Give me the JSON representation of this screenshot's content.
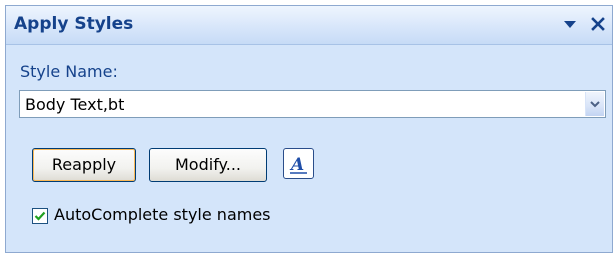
{
  "pane": {
    "title": "Apply Styles",
    "style_name_label": "Style Name:",
    "style_name_value": "Body Text,bt",
    "reapply_label": "Reapply",
    "modify_label": "Modify...",
    "format_icon_text": "A",
    "autocomplete_label": "AutoComplete style names",
    "autocomplete_checked": true
  },
  "icons": {
    "menu": "dropdown-arrow-icon",
    "close": "close-icon",
    "select_arrow": "chevron-down-icon",
    "styles_pane": "styles-pane-icon",
    "checkmark": "checkmark-icon"
  },
  "colors": {
    "title_text": "#15428b",
    "pane_background": "#d4e5fa",
    "button_border": "#003c74"
  }
}
